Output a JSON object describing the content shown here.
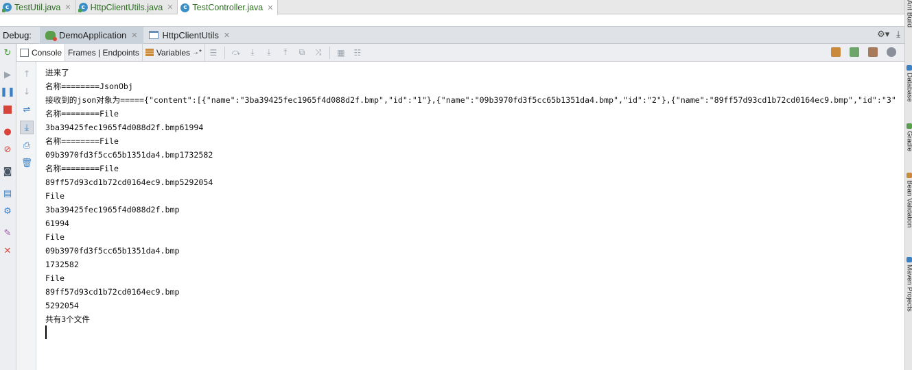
{
  "editor_tabs": [
    {
      "label": "TestUtil.java",
      "active": false
    },
    {
      "label": "HttpClientUtils.java",
      "active": false
    },
    {
      "label": "TestController.java",
      "active": true
    }
  ],
  "debug": {
    "title": "Debug:",
    "tabs": [
      {
        "label": "DemoApplication",
        "active": true
      },
      {
        "label": "HttpClientUtils",
        "active": false
      }
    ]
  },
  "debug_toolbar": {
    "console_label": "Console",
    "frames_label": "Frames | Endpoints",
    "variables_label": "Variables",
    "variables_arrow": "→*"
  },
  "right_sidebar": [
    "Ant Build",
    "Database",
    "Gradle",
    "Bean Validation",
    "Maven Projects"
  ],
  "console_lines": [
    "进来了",
    "名称========JsonObj",
    "接收到的json对象为====={\"content\":[{\"name\":\"3ba39425fec1965f4d088d2f.bmp\",\"id\":\"1\"},{\"name\":\"09b3970fd3f5cc65b1351da4.bmp\",\"id\":\"2\"},{\"name\":\"89ff57d93cd1b72cd0164ec9.bmp\",\"id\":\"3\"",
    "名称========File",
    "3ba39425fec1965f4d088d2f.bmp61994",
    "名称========File",
    "09b3970fd3f5cc65b1351da4.bmp1732582",
    "名称========File",
    "89ff57d93cd1b72cd0164ec9.bmp5292054",
    "File",
    "3ba39425fec1965f4d088d2f.bmp",
    "61994",
    "File",
    "09b3970fd3f5cc65b1351da4.bmp",
    "1732582",
    "File",
    "89ff57d93cd1b72cd0164ec9.bmp",
    "5292054",
    "共有3个文件"
  ],
  "colors": {
    "java_class_icon": "#3b8fc7",
    "tab_text": "#2a6e1e",
    "debug_bar": "#dfe3e8",
    "resume_green": "#4a9e3a",
    "stop_red": "#d9443a"
  }
}
